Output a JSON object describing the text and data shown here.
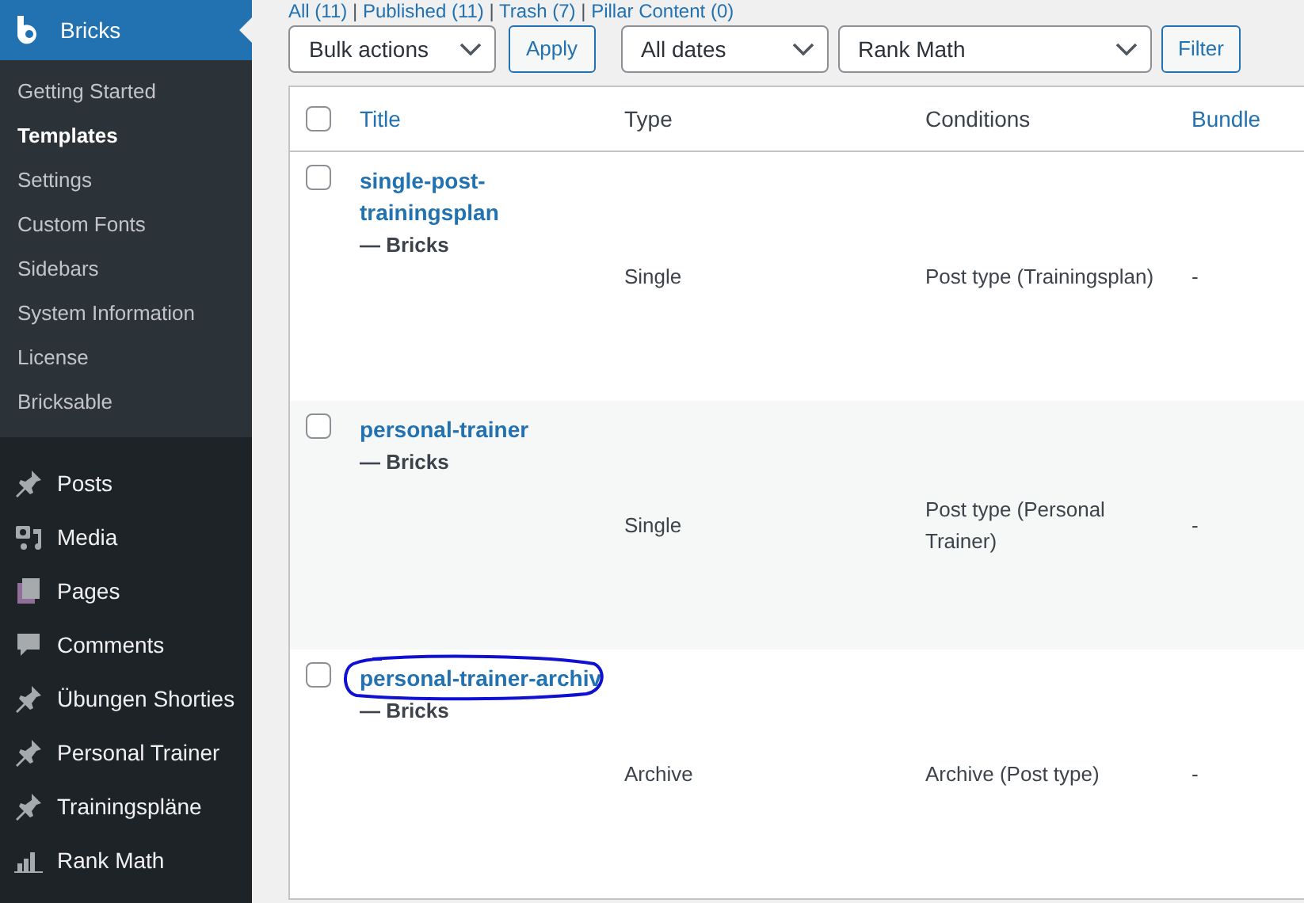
{
  "sidebar": {
    "active_menu": {
      "label": "Bricks"
    },
    "submenu": [
      {
        "label": "Getting Started",
        "selected": false
      },
      {
        "label": "Templates",
        "selected": true
      },
      {
        "label": "Settings",
        "selected": false
      },
      {
        "label": "Custom Fonts",
        "selected": false
      },
      {
        "label": "Sidebars",
        "selected": false
      },
      {
        "label": "System Information",
        "selected": false
      },
      {
        "label": "License",
        "selected": false
      },
      {
        "label": "Bricksable",
        "selected": false
      }
    ],
    "items": [
      {
        "label": "Posts",
        "kind": "pin"
      },
      {
        "label": "Media",
        "kind": "media"
      },
      {
        "label": "Pages",
        "kind": "pages"
      },
      {
        "label": "Comments",
        "kind": "comment"
      },
      {
        "label": "Übungen Shorties",
        "kind": "pin"
      },
      {
        "label": "Personal Trainer",
        "kind": "pin"
      },
      {
        "label": "Trainingspläne",
        "kind": "pin"
      },
      {
        "label": "Rank Math",
        "kind": "chart"
      }
    ]
  },
  "status_links": [
    "All (11)",
    "Published (11)",
    "Trash (7)",
    "Pillar Content (0)"
  ],
  "status_separator": "|",
  "filters": {
    "bulk_actions": "Bulk actions",
    "apply": "Apply",
    "dates": "All dates",
    "seo": "Rank Math",
    "filter": "Filter"
  },
  "table": {
    "select_all_checked": false,
    "columns": [
      {
        "label": "Title",
        "kind": "link"
      },
      {
        "label": "Type",
        "kind": "text"
      },
      {
        "label": "Conditions",
        "kind": "text"
      },
      {
        "label": "Bundle",
        "kind": "link"
      }
    ],
    "rows": [
      {
        "title": "single-post-trainingsplan",
        "suffix": "— Bricks",
        "type": "Single",
        "conditions": "Post type (Trainingsplan)",
        "bundle": "-",
        "checked": false,
        "circled": false
      },
      {
        "title": "personal-trainer",
        "suffix": "— Bricks",
        "type": "Single",
        "conditions": "Post type (Personal Trainer)",
        "bundle": "-",
        "checked": false,
        "circled": false
      },
      {
        "title": "personal-trainer-archiv",
        "suffix": "— Bricks",
        "type": "Archive",
        "conditions": "Archive (Post type)",
        "bundle": "-",
        "checked": false,
        "circled": true
      }
    ]
  }
}
